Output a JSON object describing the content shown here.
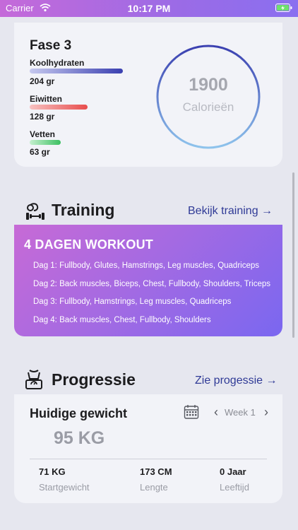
{
  "status_bar": {
    "carrier": "Carrier",
    "time": "10:17 PM"
  },
  "macros": {
    "title": "Fase 3",
    "items": [
      {
        "name": "Koolhydraten",
        "value": "204 gr",
        "color_start": "#c6c9ef",
        "color_end": "#3a3fb0"
      },
      {
        "name": "Eiwitten",
        "value": "128 gr",
        "color_start": "#f7c1c1",
        "color_end": "#e84d4d"
      },
      {
        "name": "Vetten",
        "value": "63 gr",
        "color_start": "#c6f0cf",
        "color_end": "#3cc062"
      }
    ],
    "calories": {
      "value": "1900",
      "label": "Calorieën"
    }
  },
  "training": {
    "title": "Training",
    "link": "Bekijk training →",
    "workout_title": "4 DAGEN WORKOUT",
    "days": [
      "Dag 1: Fullbody, Glutes, Hamstrings, Leg muscles, Quadriceps",
      "Dag 2: Back muscles, Biceps, Chest, Fullbody, Shoulders, Triceps",
      "Dag 3: Fullbody, Hamstrings, Leg muscles, Quadriceps",
      "Dag 4: Back muscles, Chest, Fullbody, Shoulders"
    ]
  },
  "progress": {
    "title": "Progressie",
    "link": "Zie progessie →",
    "card_title": "Huidige gewicht",
    "current_weight": "95 KG",
    "week_label": "Week 1",
    "prev": "‹",
    "next": "›",
    "stats": [
      {
        "value": "71 KG",
        "label": "Startgewicht"
      },
      {
        "value": "173 CM",
        "label": "Lengte"
      },
      {
        "value": "0 Jaar",
        "label": "Leeftijd"
      }
    ]
  },
  "colors": {
    "accent": "#2f3a96",
    "gradient_start": "#c76ad6",
    "gradient_end": "#7a67f0"
  }
}
